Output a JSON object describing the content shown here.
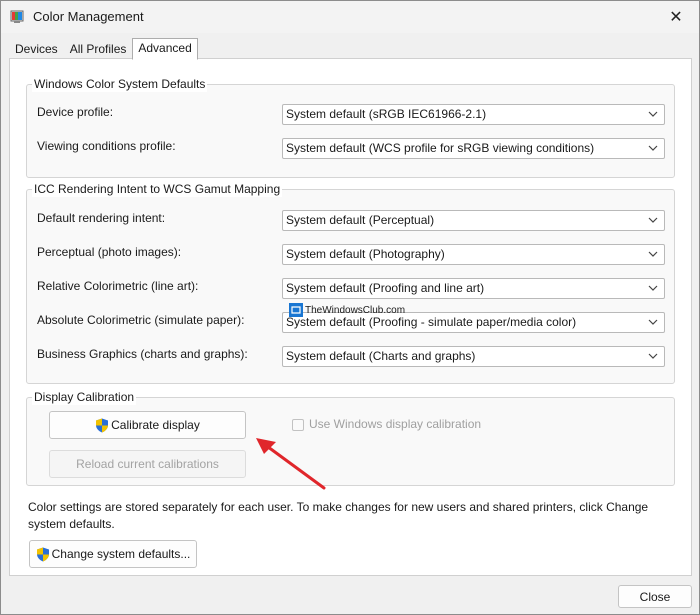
{
  "window": {
    "title": "Color Management",
    "close_glyph": "✕"
  },
  "tabs": [
    {
      "label": "Devices",
      "active": false
    },
    {
      "label": "All Profiles",
      "active": false
    },
    {
      "label": "Advanced",
      "active": true
    }
  ],
  "wcs_defaults": {
    "title": "Windows Color System Defaults",
    "rows": [
      {
        "label": "Device profile:",
        "value": "System default (sRGB IEC61966-2.1)"
      },
      {
        "label": "Viewing conditions profile:",
        "value": "System default (WCS profile for sRGB viewing conditions)"
      }
    ]
  },
  "icc_mapping": {
    "title": "ICC Rendering Intent to WCS Gamut Mapping",
    "rows": [
      {
        "label": "Default rendering intent:",
        "value": "System default (Perceptual)"
      },
      {
        "label": "Perceptual (photo images):",
        "value": "System default (Photography)"
      },
      {
        "label": "Relative Colorimetric (line art):",
        "value": "System default (Proofing and line art)"
      },
      {
        "label": "Absolute Colorimetric (simulate paper):",
        "value": "System default (Proofing - simulate paper/media color)"
      },
      {
        "label": "Business Graphics (charts and graphs):",
        "value": "System default (Charts and graphs)"
      }
    ]
  },
  "calibration": {
    "title": "Display Calibration",
    "calibrate_button": "Calibrate display",
    "reload_button": "Reload current calibrations",
    "use_windows_calibration": {
      "label": "Use Windows display calibration",
      "checked": false,
      "enabled": false
    }
  },
  "info_text": "Color settings are stored separately for each user. To make changes for new users and shared printers, click Change system defaults.",
  "change_defaults_button": "Change system defaults...",
  "close_button": "Close",
  "watermark": "TheWindowsClub.com",
  "colors": {
    "accent_red": "#e0262b",
    "shield_blue": "#2a6fd6",
    "shield_yellow": "#f2c200"
  }
}
